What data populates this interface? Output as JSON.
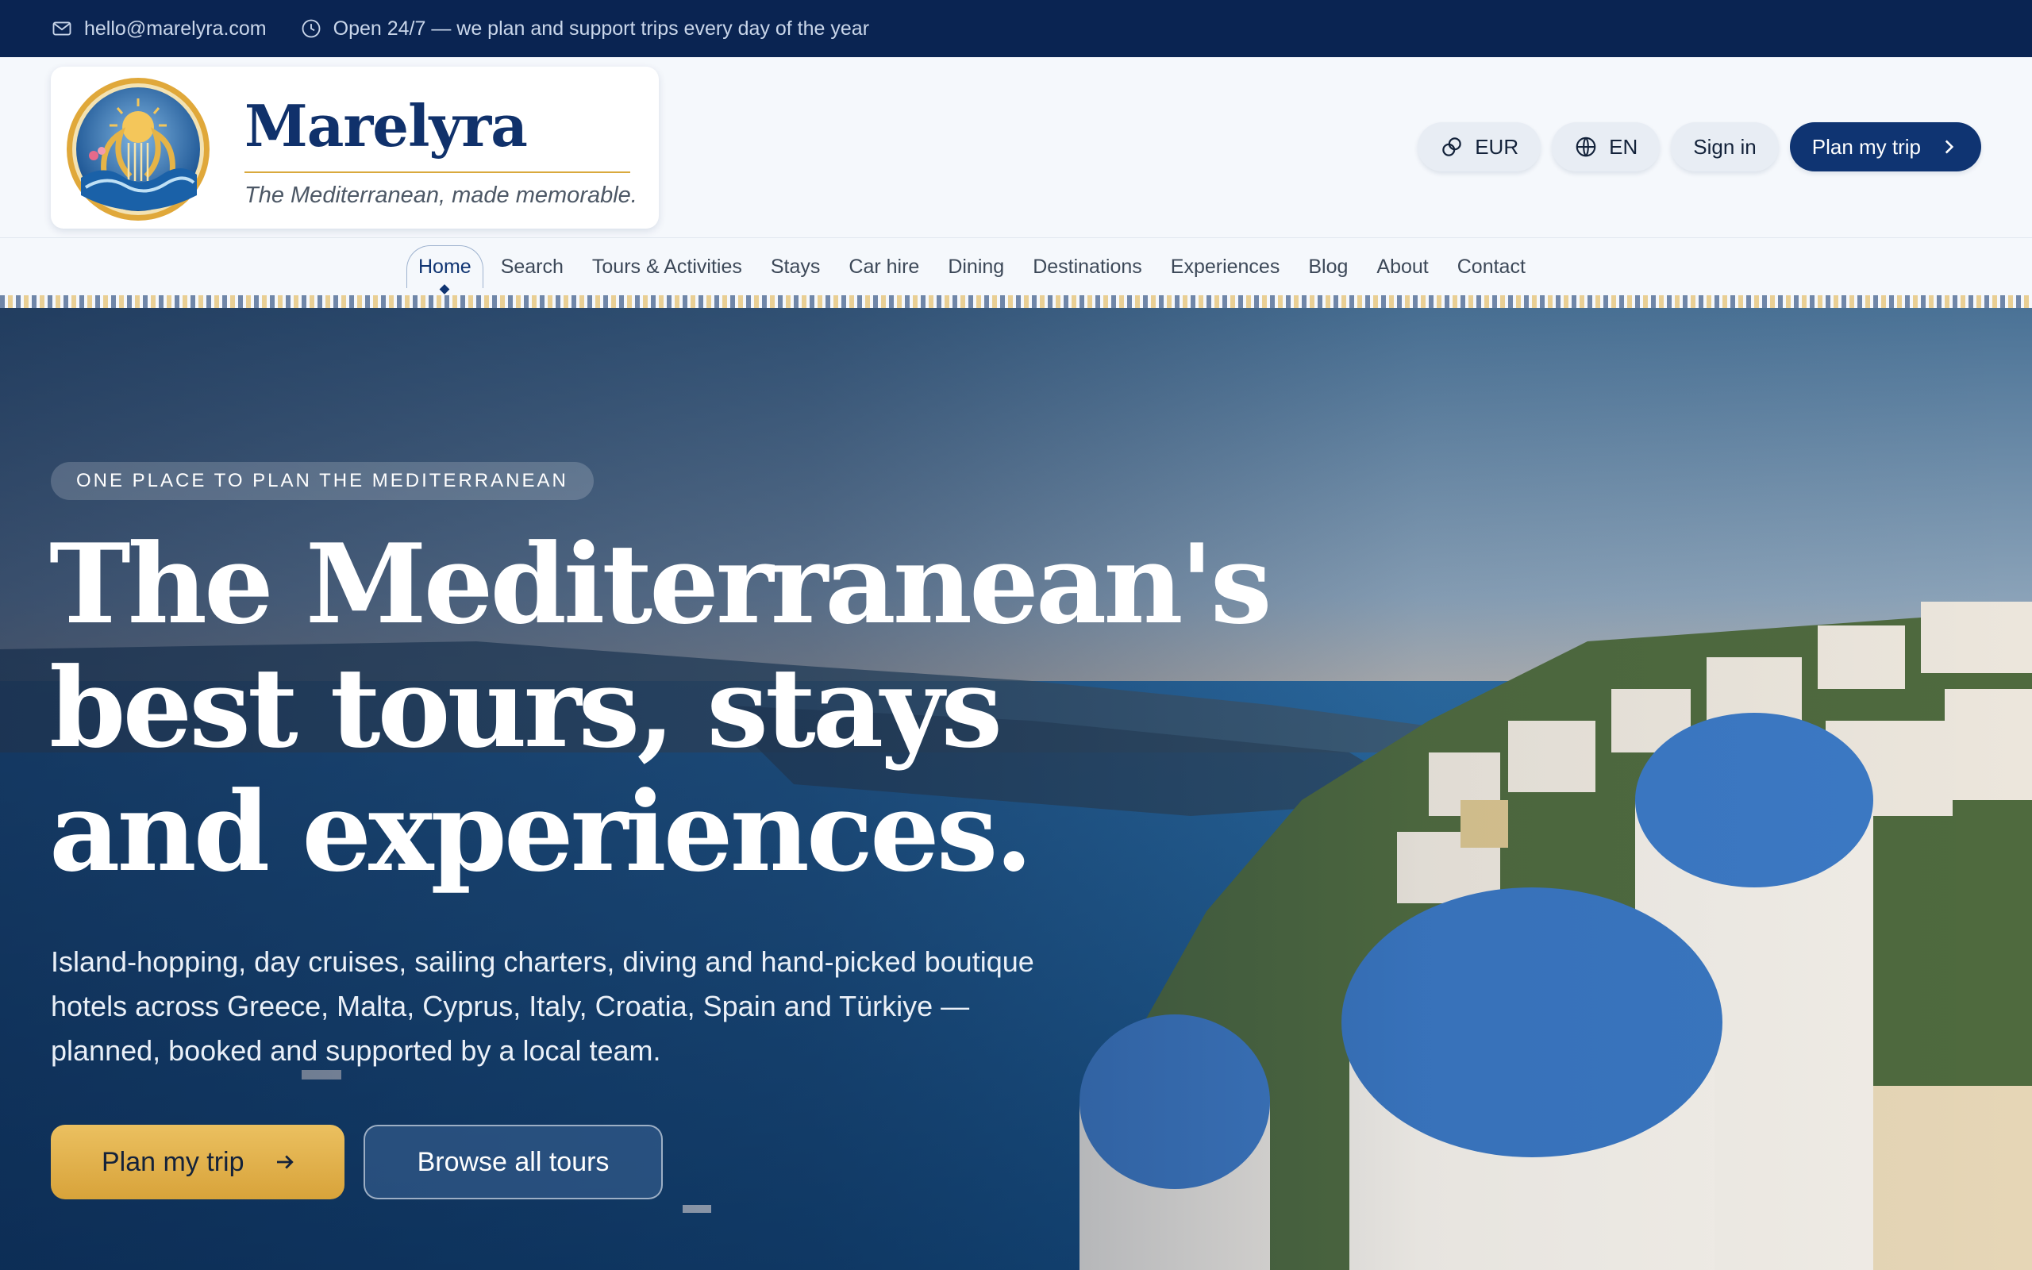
{
  "topbar": {
    "email": "hello@marelyra.com",
    "hours": "Open 24/7 — we plan and support trips every day of the year"
  },
  "brand": {
    "name": "Marelyra",
    "tagline": "The Mediterranean, made memorable."
  },
  "header_actions": {
    "currency": "EUR",
    "language": "EN",
    "sign_in": "Sign in",
    "plan_trip": "Plan my trip"
  },
  "nav": {
    "items": [
      {
        "label": "Home",
        "active": true
      },
      {
        "label": "Search"
      },
      {
        "label": "Tours & Activities"
      },
      {
        "label": "Stays"
      },
      {
        "label": "Car hire"
      },
      {
        "label": "Dining"
      },
      {
        "label": "Destinations"
      },
      {
        "label": "Experiences"
      },
      {
        "label": "Blog"
      },
      {
        "label": "About"
      },
      {
        "label": "Contact"
      }
    ]
  },
  "hero": {
    "eyebrow": "ONE PLACE TO PLAN THE MEDITERRANEAN",
    "headline": [
      "The Mediterranean's",
      "best tours, stays",
      "and experiences."
    ],
    "lede": [
      "Island-hopping, day cruises, sailing charters, diving and hand-picked boutique",
      "hotels across Greece, Malta, Cyprus, Italy, Croatia, Spain and Türkiye —",
      "planned, booked and supported by a local team."
    ],
    "cta_primary": "Plan my trip",
    "cta_secondary": "Browse all tours"
  },
  "colors": {
    "navy": "#0a2452",
    "brand_blue": "#0f3472",
    "gold": "#d8a33a",
    "header_bg": "#f5f8fc"
  },
  "icons": {
    "email": "mail-icon",
    "hours": "clock-icon",
    "currency": "currency-exchange-icon",
    "language": "globe-icon",
    "cta_chevron": "chevron-right-icon",
    "cta_arrow": "arrow-right-icon"
  }
}
